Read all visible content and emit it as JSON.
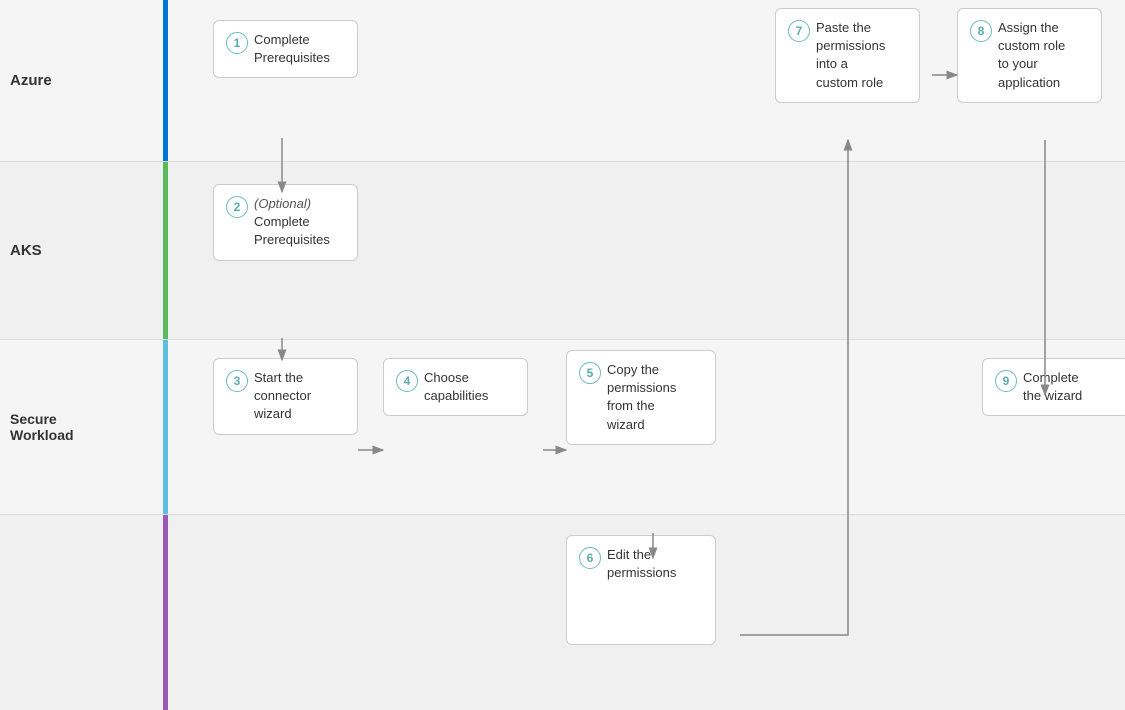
{
  "swimlanes": [
    {
      "id": "azure",
      "label": "Azure",
      "color": "#0078d4",
      "bg": "#f5f5f5"
    },
    {
      "id": "aks",
      "label": "AKS",
      "color": "#5cb85c",
      "bg": "#f0f0f0"
    },
    {
      "id": "secure",
      "label": "Secure\nWorkload",
      "color": "#5bc0de",
      "bg": "#f5f5f5"
    },
    {
      "id": "bottom",
      "label": "",
      "color": "#9b59b6",
      "bg": "#f0f0f0"
    }
  ],
  "steps": [
    {
      "id": 1,
      "number": "1",
      "text": "Complete\nPrerequisites",
      "swimlane": "azure"
    },
    {
      "id": 2,
      "number": "2",
      "text": "(Optional)\nComplete\nPrerequisites",
      "swimlane": "aks",
      "optional": true
    },
    {
      "id": 3,
      "number": "3",
      "text": "Start the\nconnector\nwizard",
      "swimlane": "secure"
    },
    {
      "id": 4,
      "number": "4",
      "text": "Choose\ncapabilities",
      "swimlane": "secure"
    },
    {
      "id": 5,
      "number": "5",
      "text": "Copy the\npermissions\nfrom the\nwizard",
      "swimlane": "secure"
    },
    {
      "id": 6,
      "number": "6",
      "text": "Edit the\npermissions",
      "swimlane": "bottom"
    },
    {
      "id": 7,
      "number": "7",
      "text": "Paste the\npermissions\ninto a\ncustom role",
      "swimlane": "azure"
    },
    {
      "id": 8,
      "number": "8",
      "text": "Assign the\ncustom role\nto your\napplication",
      "swimlane": "azure"
    },
    {
      "id": 9,
      "number": "9",
      "text": "Complete\nthe wizard",
      "swimlane": "secure"
    }
  ],
  "arrows": "flow connecting steps 1 through 9"
}
